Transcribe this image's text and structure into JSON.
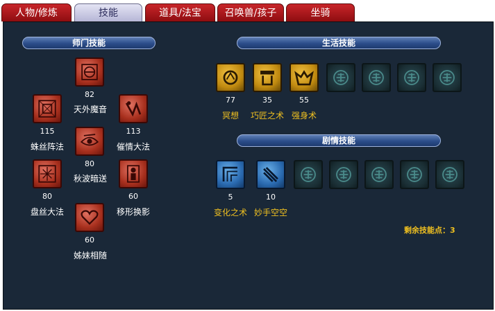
{
  "tabs": [
    "人物/修炼",
    "技能",
    "道具/法宝",
    "召唤兽/孩子",
    "坐骑"
  ],
  "sections": {
    "school": "师门技能",
    "life": "生活技能",
    "story": "剧情技能"
  },
  "school_skills": [
    {
      "name": "天外魔音",
      "level": "82",
      "icon": "demon-sound-icon"
    },
    {
      "name": "蛛丝阵法",
      "level": "115",
      "icon": "spider-web-icon"
    },
    {
      "name": "催情大法",
      "level": "113",
      "icon": "charm-icon"
    },
    {
      "name": "秋波暗送",
      "level": "80",
      "icon": "eye-wink-icon"
    },
    {
      "name": "盘丝大法",
      "level": "80",
      "icon": "silk-maze-icon"
    },
    {
      "name": "移形换影",
      "level": "60",
      "icon": "shadow-move-icon"
    },
    {
      "name": "姊妹相随",
      "level": "60",
      "icon": "heart-icon"
    }
  ],
  "life_skills": [
    {
      "name": "冥想",
      "level": "77",
      "icon": "meditation-icon"
    },
    {
      "name": "巧匠之术",
      "level": "35",
      "icon": "craftsman-icon"
    },
    {
      "name": "强身术",
      "level": "55",
      "icon": "strengthen-icon"
    }
  ],
  "story_skills": [
    {
      "name": "变化之术",
      "level": "5",
      "icon": "transform-icon"
    },
    {
      "name": "妙手空空",
      "level": "10",
      "icon": "steal-icon"
    }
  ],
  "remaining_points": "剩余技能点：3",
  "colors": {
    "tab_red": "#b01a1e",
    "panel": "#1a2838",
    "gold_text": "#f0c020"
  }
}
